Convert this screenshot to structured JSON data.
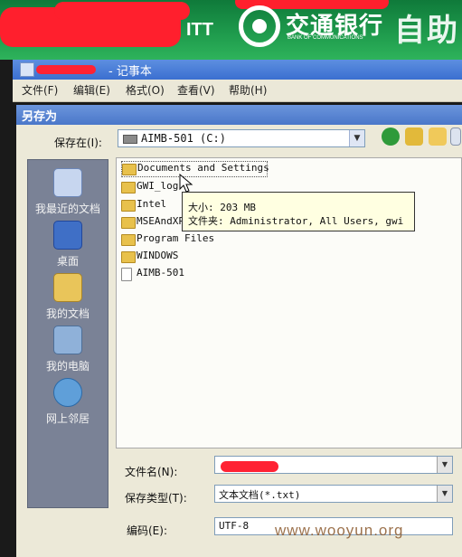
{
  "banner": {
    "bank_name": "交通银行",
    "bank_subtitle": "BANK OF COMMUNICATIONS",
    "tail_text": "自助",
    "partial_text": "ITT"
  },
  "notepad": {
    "title": "- 记事本",
    "menu": [
      "文件(F)",
      "编辑(E)",
      "格式(O)",
      "查看(V)",
      "帮助(H)"
    ]
  },
  "dialog": {
    "title": "另存为",
    "save_in_label": "保存在(I):",
    "save_in_value": "AIMB-501 (C:)",
    "places": [
      "我最近的文档",
      "桌面",
      "我的文档",
      "我的电脑",
      "网上邻居"
    ],
    "files": [
      {
        "name": "Documents and Settings",
        "type": "folder"
      },
      {
        "name": "GWI_log",
        "type": "folder"
      },
      {
        "name": "Intel",
        "type": "folder"
      },
      {
        "name": "MSEAndXP",
        "type": "folder"
      },
      {
        "name": "Program Files",
        "type": "folder"
      },
      {
        "name": "WINDOWS",
        "type": "folder"
      },
      {
        "name": "AIMB-501",
        "type": "file"
      }
    ],
    "tooltip": {
      "size": "大小: 203 MB",
      "folder": "文件夹: Administrator, All Users, gwi"
    },
    "filename_label": "文件名(N):",
    "filename_value": "",
    "savetype_label": "保存类型(T):",
    "savetype_value": "文本文档(*.txt)",
    "encoding_label": "编码(E):",
    "encoding_value": "UTF-8"
  },
  "watermark": "www.wooyun.org",
  "colors": {
    "banner_green": "#1e9a4c",
    "title_blue": "#4a77c9",
    "dialog_bg": "#ece9d8",
    "places_bg": "#7a8296",
    "redaction_red": "#ff1f2d"
  }
}
